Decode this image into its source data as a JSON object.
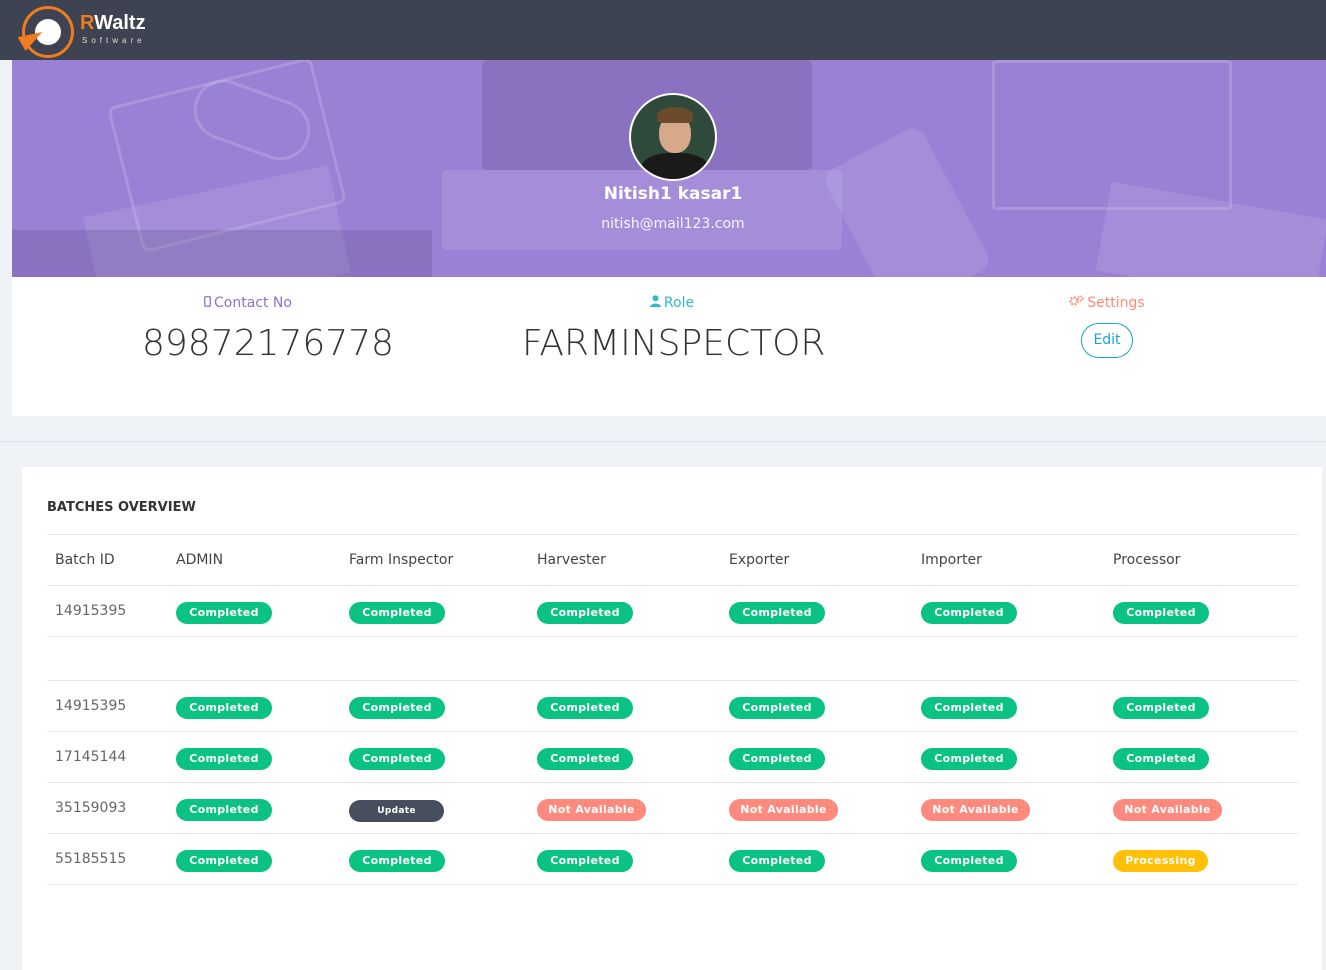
{
  "brand": {
    "name_r": "R",
    "name_rest": "Waltz",
    "sub": "Software"
  },
  "profile": {
    "name": "Nitish1 kasar1",
    "email": "nitish@mail123.com"
  },
  "info": {
    "contact_label": "Contact No",
    "contact_value": "89872176778",
    "role_label": "Role",
    "role_value": "FARMINSPECTOR",
    "settings_label": "Settings",
    "edit_label": "Edit"
  },
  "colors": {
    "purple": "#9b81d6",
    "contact": "#8e6fd0",
    "role": "#2fb9c9",
    "settings": "#fd8b72",
    "completed": "#0ac282",
    "not_available": "#fe8a7d",
    "processing": "#fec107",
    "update": "#474f5e"
  },
  "batches": {
    "title": "BATCHES OVERVIEW",
    "headers": [
      "Batch ID",
      "ADMIN",
      "Farm Inspector",
      "Harvester",
      "Exporter",
      "Importer",
      "Processor"
    ],
    "rows": [
      {
        "id": "14915395",
        "status": [
          "Completed",
          "Completed",
          "Completed",
          "Completed",
          "Completed",
          "Completed"
        ]
      },
      {
        "id": "14915395",
        "status": [
          "Completed",
          "Completed",
          "Completed",
          "Completed",
          "Completed",
          "Completed"
        ]
      },
      {
        "id": "17145144",
        "status": [
          "Completed",
          "Completed",
          "Completed",
          "Completed",
          "Completed",
          "Completed"
        ]
      },
      {
        "id": "35159093",
        "status": [
          "Completed",
          "Update",
          "Not Available",
          "Not Available",
          "Not Available",
          "Not Available"
        ]
      },
      {
        "id": "55185515",
        "status": [
          "Completed",
          "Completed",
          "Completed",
          "Completed",
          "Completed",
          "Processing"
        ]
      }
    ]
  }
}
